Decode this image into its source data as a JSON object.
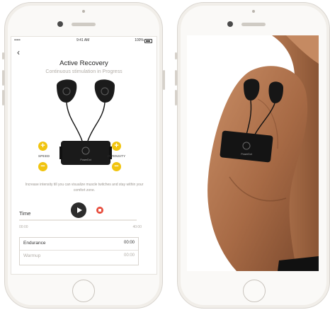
{
  "status_bar": {
    "signal": "•••••",
    "time": "9:41 AM",
    "battery": "100%"
  },
  "app": {
    "back_label": "‹",
    "title": "Active Recovery",
    "subtitle": "Continuous stimulation in Progress",
    "speed_label": "SPEED",
    "intensity_label": "INTENSITY",
    "plus_symbol": "+",
    "minus_symbol": "−",
    "device_brand": "PowerDot",
    "helper_text": "Increase intensity till you can visualize muscle twitches and stay within your comfort zone.",
    "time_label": "Time",
    "time_start": "00:00",
    "time_end": "40:00",
    "progress": 0.0,
    "phases": [
      {
        "name": "Endurance",
        "time": "00:00"
      },
      {
        "name": "Warmup",
        "time": "00:00"
      }
    ]
  },
  "device_right": {
    "brand": "PowerDot"
  },
  "colors": {
    "accent": "#f1c40f",
    "stop": "#e74c3c",
    "play": "#2c2c2c"
  }
}
